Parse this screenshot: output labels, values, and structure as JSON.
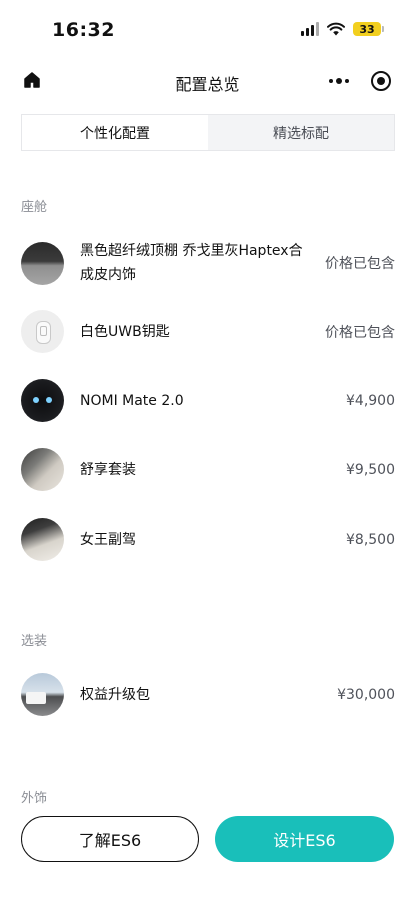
{
  "status_bar": {
    "time": "16:32",
    "battery": "33"
  },
  "nav": {
    "title": "配置总览"
  },
  "tabs": [
    {
      "label": "个性化配置",
      "active": true
    },
    {
      "label": "精选标配",
      "active": false
    }
  ],
  "sections": {
    "cabin": {
      "title": "座舱",
      "items": [
        {
          "name": "黑色超纤绒顶棚 乔戈里灰Haptex合成皮内饰",
          "price": "价格已包含"
        },
        {
          "name": "白色UWB钥匙",
          "price": "价格已包含"
        },
        {
          "name": "NOMI Mate 2.0",
          "price": "¥4,900"
        },
        {
          "name": "舒享套装",
          "price": "¥9,500"
        },
        {
          "name": "女王副驾",
          "price": "¥8,500"
        }
      ]
    },
    "options": {
      "title": "选装",
      "items": [
        {
          "name": "权益升级包",
          "price": "¥30,000"
        }
      ]
    },
    "exterior": {
      "title": "外饰"
    }
  },
  "buttons": {
    "learn": "了解ES6",
    "design": "设计ES6"
  },
  "colors": {
    "accent": "#19bfba"
  }
}
